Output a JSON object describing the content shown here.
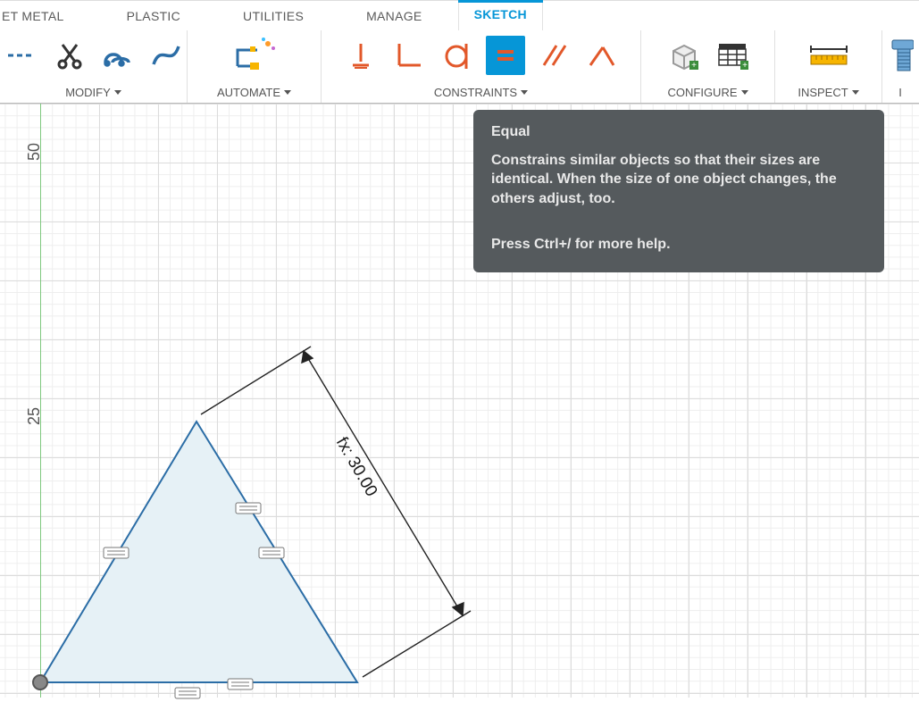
{
  "tabs": {
    "sheet_metal": "ET METAL",
    "plastic": "PLASTIC",
    "utilities": "UTILITIES",
    "manage": "MANAGE",
    "sketch": "SKETCH"
  },
  "panels": {
    "modify": {
      "label": "MODIFY"
    },
    "automate": {
      "label": "AUTOMATE"
    },
    "constraints": {
      "label": "CONSTRAINTS"
    },
    "configure": {
      "label": "CONFIGURE"
    },
    "inspect": {
      "label": "INSPECT"
    },
    "insert_cut": {
      "label": "I"
    }
  },
  "tooltip": {
    "title": "Equal",
    "body": "Constrains similar objects so that their sizes are identical. When the size of one object changes, the others adjust, too.",
    "help": "Press Ctrl+/ for more help."
  },
  "axis": {
    "t50": "50",
    "t25": "25"
  },
  "sketch": {
    "dim_label": "fx: 30.00"
  }
}
